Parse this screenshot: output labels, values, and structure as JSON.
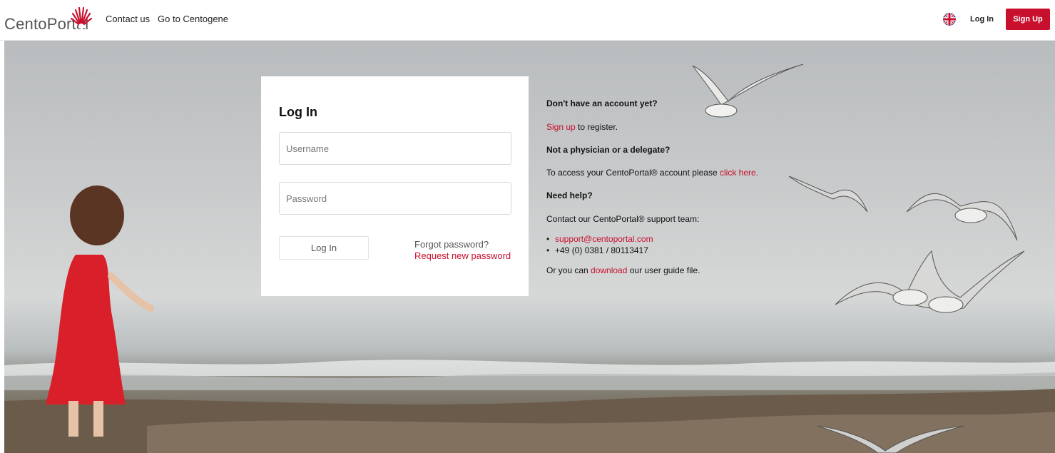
{
  "header": {
    "logo_text": "CentoPortal",
    "nav": [
      {
        "label": "Contact us"
      },
      {
        "label": "Go to Centogene"
      }
    ],
    "login_label": "Log In",
    "signup_label": "Sign Up",
    "language_icon": "uk-flag-icon"
  },
  "login_card": {
    "title": "Log In",
    "username_placeholder": "Username",
    "password_placeholder": "Password",
    "login_button": "Log In",
    "forgot_text": "Forgot password?",
    "request_link": "Request new password"
  },
  "info": {
    "no_account_heading": "Don't have an account yet?",
    "signup_link": "Sign up",
    "signup_suffix": " to register.",
    "not_physician_heading": "Not a physician or a delegate?",
    "access_text": "To access your CentoPortal® account please ",
    "click_here_link": "click here.",
    "need_help_heading": "Need help?",
    "contact_text": "Contact our CentoPortal® support team:",
    "support_email": "support@centoportal.com",
    "support_phone": "+49 (0) 0381 / 80113417",
    "guide_prefix": "Or you can ",
    "download_link": "download",
    "guide_suffix": " our user guide file."
  },
  "colors": {
    "brand_red": "#c8102e"
  }
}
